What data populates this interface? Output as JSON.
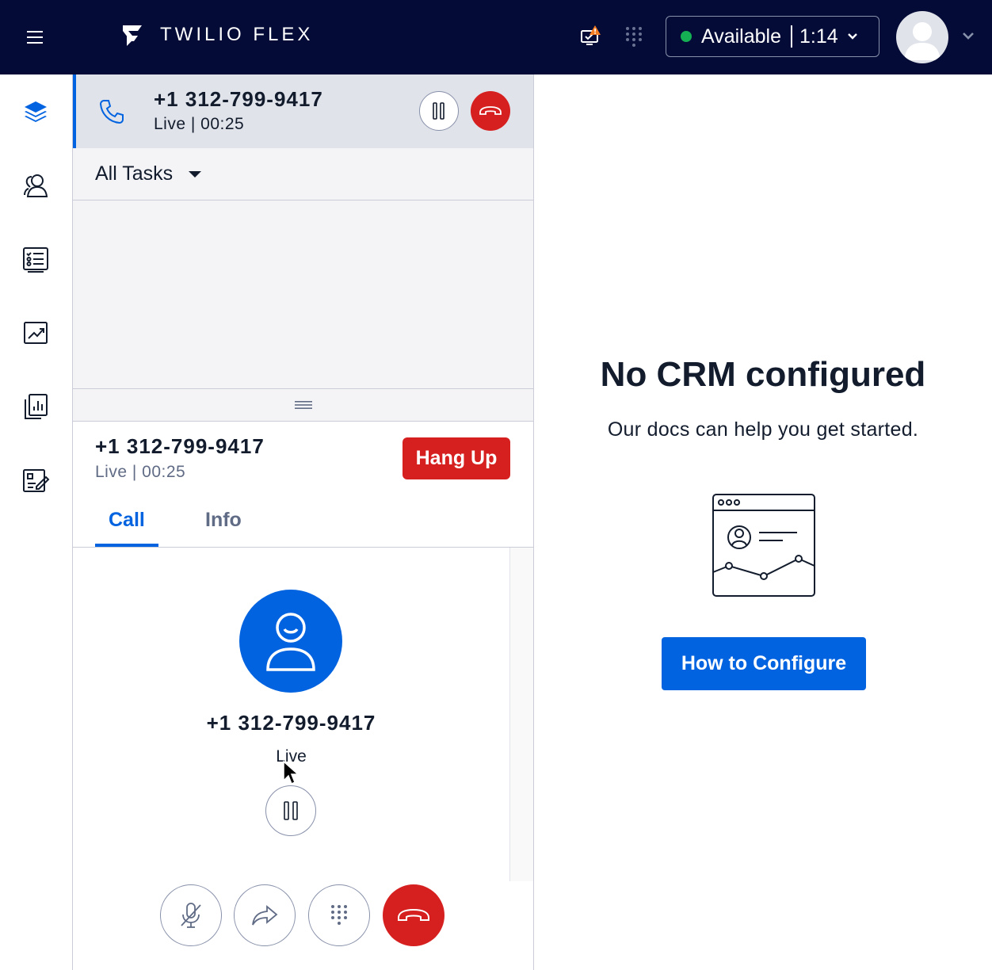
{
  "app": {
    "title": "TWILIO FLEX",
    "status": {
      "label": "Available",
      "time": "1:14",
      "color": "#14b053"
    },
    "accent": "#0263e0",
    "danger": "#d61f1f",
    "topbar_bg": "#030b36"
  },
  "nav": {
    "items": [
      {
        "icon": "layers-icon",
        "active": true
      },
      {
        "icon": "agents-icon"
      },
      {
        "icon": "queues-list-icon"
      },
      {
        "icon": "analytics-trend-icon"
      },
      {
        "icon": "reports-icon"
      },
      {
        "icon": "quality-edit-icon"
      }
    ]
  },
  "task_card": {
    "number": "+1 312-799-9417",
    "status": "Live | 00:25"
  },
  "filter": {
    "label": "All Tasks"
  },
  "call": {
    "number": "+1 312-799-9417",
    "status": "Live | 00:25",
    "hangup_label": "Hang Up",
    "tabs": [
      {
        "label": "Call",
        "active": true
      },
      {
        "label": "Info"
      }
    ],
    "caller_number": "+1 312-799-9417",
    "caller_status": "Live"
  },
  "crm": {
    "title": "No CRM configured",
    "subtitle": "Our docs can help you get started.",
    "button_label": "How to Configure"
  }
}
